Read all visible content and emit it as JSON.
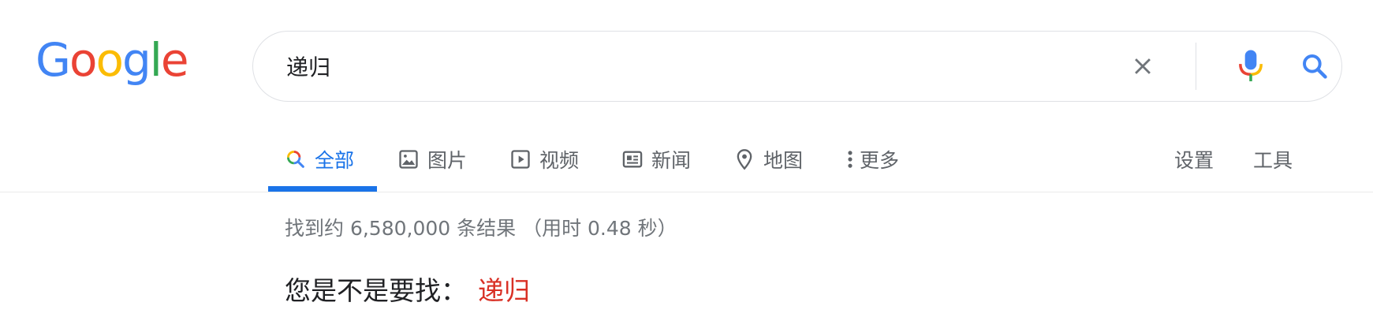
{
  "logo": {
    "letters": [
      "G",
      "o",
      "o",
      "g",
      "l",
      "e"
    ],
    "colors": [
      "#4285f4",
      "#ea4335",
      "#fbbc05",
      "#4285f4",
      "#34a853",
      "#ea4335"
    ]
  },
  "search": {
    "query": "递归",
    "buttons": {
      "clear_icon": "close-icon",
      "mic_icon": "microphone-icon",
      "search_icon": "search-icon"
    }
  },
  "tabs": [
    {
      "label": "全部",
      "icon": "search-icon",
      "active": true
    },
    {
      "label": "图片",
      "icon": "image-icon"
    },
    {
      "label": "视频",
      "icon": "video-icon"
    },
    {
      "label": "新闻",
      "icon": "news-icon"
    },
    {
      "label": "地图",
      "icon": "map-pin-icon"
    },
    {
      "label": "更多",
      "icon": "more-vert-icon"
    }
  ],
  "tools": {
    "settings_label": "设置",
    "tools_label": "工具"
  },
  "results": {
    "stats_text": "找到约 6,580,000 条结果 （用时 0.48 秒）",
    "did_you_mean_label": "您是不是要找：",
    "did_you_mean_link": "递归"
  },
  "colors": {
    "accent": "#1a73e8",
    "suggestion": "#d93025",
    "muted": "#70757a",
    "tab_text": "#5f6368"
  }
}
